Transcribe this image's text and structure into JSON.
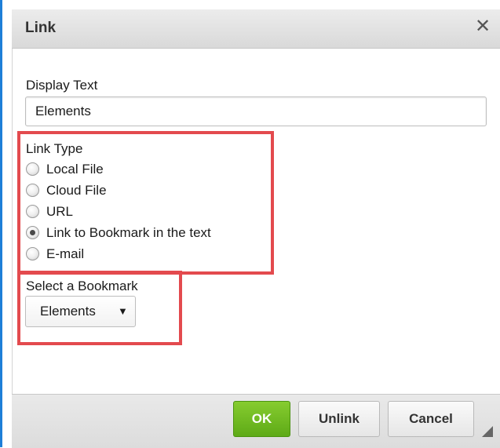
{
  "dialog": {
    "title": "Link",
    "close_icon": "close-icon"
  },
  "display_text": {
    "label": "Display Text",
    "value": "Elements"
  },
  "link_type": {
    "label": "Link Type",
    "options": [
      {
        "label": "Local File",
        "checked": false
      },
      {
        "label": "Cloud File",
        "checked": false
      },
      {
        "label": "URL",
        "checked": false
      },
      {
        "label": "Link to Bookmark in the text",
        "checked": true
      },
      {
        "label": "E-mail",
        "checked": false
      }
    ]
  },
  "bookmark": {
    "label": "Select a Bookmark",
    "selected": "Elements",
    "arrow_icon": "caret-down-icon"
  },
  "footer": {
    "ok_label": "OK",
    "unlink_label": "Unlink",
    "cancel_label": "Cancel"
  },
  "colors": {
    "highlight": "#e34a4e",
    "ok_button": "#6cb823",
    "window_edge": "#1e7fd8"
  }
}
